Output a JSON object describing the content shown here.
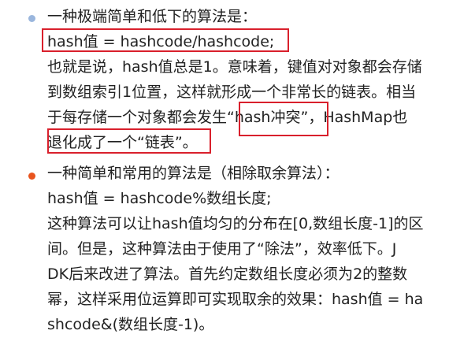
{
  "colors": {
    "text": "#222222",
    "bullet1": "#9ab6dd",
    "bullet2": "#e8541e",
    "highlight_border": "#d9202c"
  },
  "section1": {
    "heading": "一种极端简单和低下的算法是：",
    "formula": "hash值 = hashcode/hashcode;",
    "body_lines": [
      "也就是说，hash值总是1。意味着，键值对对象都会存储",
      "到数组索引1位置，这样就形成一个非常长的链表。相当",
      "于每存储一个对象都会发生“hash冲突”，HashMap也",
      "退化成了一个“链表”。"
    ]
  },
  "section2": {
    "heading": "一种简单和常用的算法是（相除取余算法）：",
    "formula": "hash值 = hashcode%数组长度;",
    "body_lines": [
      "这种算法可以让hash值均匀的分布在[0,数组长度-1]的区",
      "间。但是，这种算法由于使用了“除法”，效率低下。J",
      "DK后来改进了算法。首先约定数组长度必须为2的整数",
      "幂，这样采用位运算即可实现取余的效果：hash值 = ha",
      "shcode&(数组长度-1)。"
    ]
  }
}
